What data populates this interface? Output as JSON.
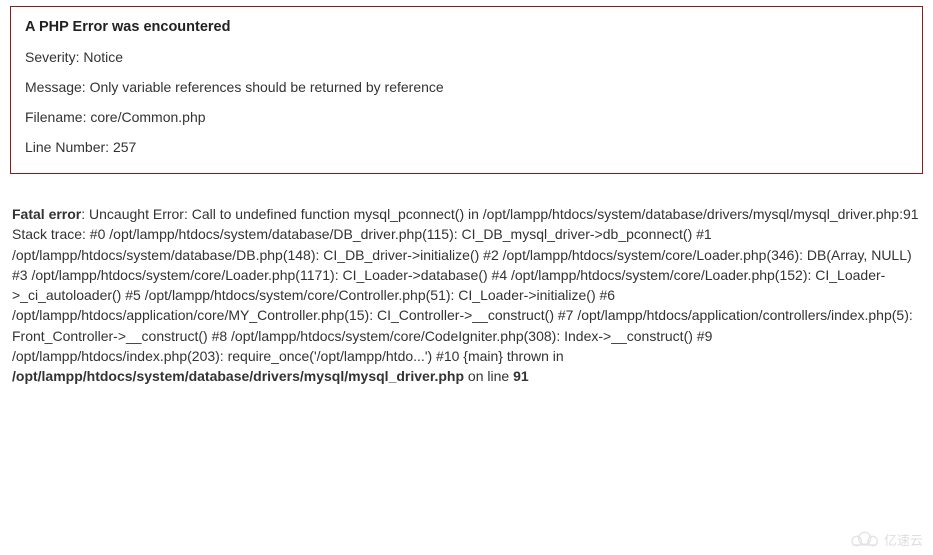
{
  "error_box": {
    "title": "A PHP Error was encountered",
    "severity_label": "Severity: ",
    "severity_value": "Notice",
    "message_label": "Message: ",
    "message_value": "Only variable references should be returned by reference",
    "filename_label": "Filename: ",
    "filename_value": "core/Common.php",
    "line_label": "Line Number: ",
    "line_value": "257"
  },
  "fatal": {
    "label": "Fatal error",
    "body": ": Uncaught Error: Call to undefined function mysql_pconnect() in /opt/lampp/htdocs/system/database/drivers/mysql/mysql_driver.php:91 Stack trace: #0 /opt/lampp/htdocs/system/database/DB_driver.php(115): CI_DB_mysql_driver->db_pconnect() #1 /opt/lampp/htdocs/system/database/DB.php(148): CI_DB_driver->initialize() #2 /opt/lampp/htdocs/system/core/Loader.php(346): DB(Array, NULL) #3 /opt/lampp/htdocs/system/core/Loader.php(1171): CI_Loader->database() #4 /opt/lampp/htdocs/system/core/Loader.php(152): CI_Loader->_ci_autoloader() #5 /opt/lampp/htdocs/system/core/Controller.php(51): CI_Loader->initialize() #6 /opt/lampp/htdocs/application/core/MY_Controller.php(15): CI_Controller->__construct() #7 /opt/lampp/htdocs/application/controllers/index.php(5): Front_Controller->__construct() #8 /opt/lampp/htdocs/system/core/CodeIgniter.php(308): Index->__construct() #9 /opt/lampp/htdocs/index.php(203): require_once('/opt/lampp/htdo...') #10 {main} thrown in ",
    "thrown_file": "/opt/lampp/htdocs/system/database/drivers/mysql/mysql_driver.php",
    "on_line_text": " on line ",
    "thrown_line": "91"
  },
  "watermark": {
    "text": "亿速云"
  }
}
